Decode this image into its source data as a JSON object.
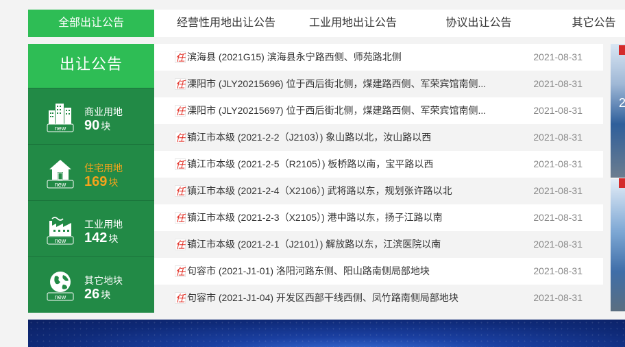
{
  "tabs": [
    {
      "label": "全部出让公告",
      "active": true
    },
    {
      "label": "经营性用地出让公告",
      "active": false
    },
    {
      "label": "工业用地出让公告",
      "active": false
    },
    {
      "label": "协议出让公告",
      "active": false
    },
    {
      "label": "其它公告",
      "active": false
    }
  ],
  "sidebar": {
    "title": "出让公告",
    "categories": [
      {
        "name": "商业用地",
        "count": "90",
        "unit": "块",
        "icon": "buildings-icon",
        "highlight": false
      },
      {
        "name": "住宅用地",
        "count": "169",
        "unit": "块",
        "icon": "house-icon",
        "highlight": true
      },
      {
        "name": "工业用地",
        "count": "142",
        "unit": "块",
        "icon": "factory-icon",
        "highlight": false
      },
      {
        "name": "其它地块",
        "count": "26",
        "unit": "块",
        "icon": "globe-icon",
        "highlight": false
      }
    ],
    "new_badge": "new"
  },
  "notices": [
    {
      "badge": "任",
      "title": "滨海县 (2021G15) 滨海县永宁路西侧、师苑路北侧",
      "date": "2021-08-31"
    },
    {
      "badge": "任",
      "title": "溧阳市 (JLY20215696) 位于西后街北侧，煤建路西侧、军荣宾馆南侧...",
      "date": "2021-08-31"
    },
    {
      "badge": "任",
      "title": "溧阳市 (JLY20215697) 位于西后街北侧，煤建路西侧、军荣宾馆南侧...",
      "date": "2021-08-31"
    },
    {
      "badge": "任",
      "title": "镇江市本级 (2021-2-2（J2103）) 象山路以北，汝山路以西",
      "date": "2021-08-31"
    },
    {
      "badge": "任",
      "title": "镇江市本级 (2021-2-5（R2105）) 板桥路以南，宝平路以西",
      "date": "2021-08-31"
    },
    {
      "badge": "任",
      "title": "镇江市本级 (2021-2-4（X2106）) 武将路以东，规划张许路以北",
      "date": "2021-08-31"
    },
    {
      "badge": "任",
      "title": "镇江市本级 (2021-2-3（X2105）) 港中路以东，扬子江路以南",
      "date": "2021-08-31"
    },
    {
      "badge": "任",
      "title": "镇江市本级 (2021-2-1（J2101）) 解放路以东，江滨医院以南",
      "date": "2021-08-31"
    },
    {
      "badge": "任",
      "title": "句容市 (2021-J1-01) 洛阳河路东侧、阳山路南侧局部地块",
      "date": "2021-08-31"
    },
    {
      "badge": "任",
      "title": "句容市 (2021-J1-04) 开发区西部干线西侧、凤竹路南侧局部地块",
      "date": "2021-08-31"
    }
  ],
  "banner": {
    "digit": "2"
  },
  "colors": {
    "green": "#2ebd55",
    "dark_green": "#228a46",
    "orange": "#f5a31c",
    "red": "#e22a20"
  }
}
